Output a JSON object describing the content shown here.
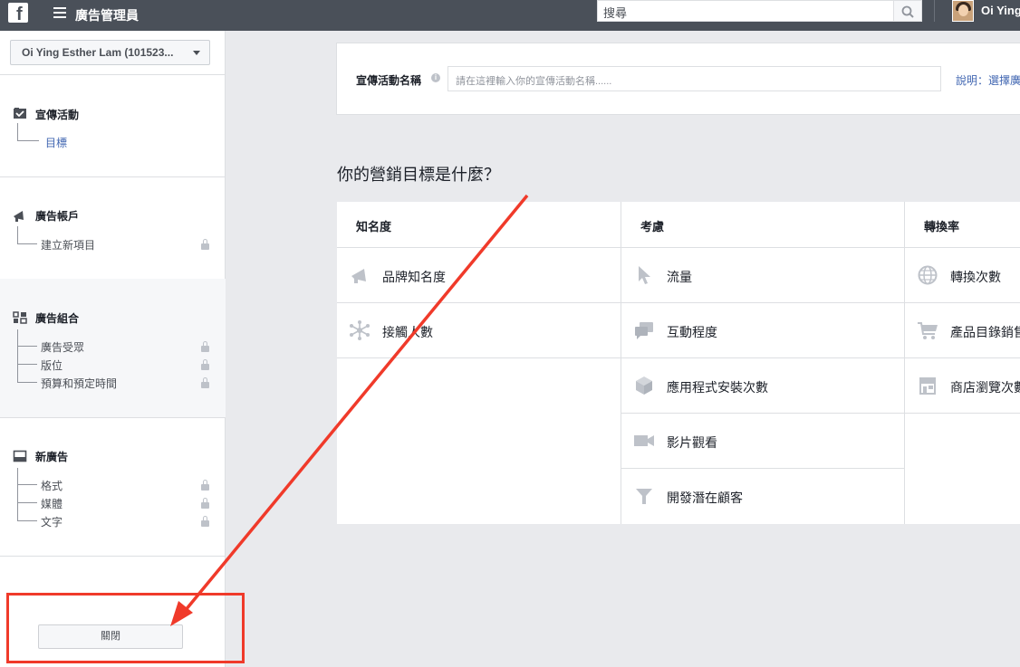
{
  "header": {
    "logo": "f",
    "app_title": "廣告管理員",
    "search_placeholder": "搜尋",
    "user_name": "Oi Ying"
  },
  "sidebar": {
    "account_selector": "Oi Ying Esther Lam (101523...",
    "sections": [
      {
        "title": "宣傳活動",
        "icon": "checkbox-icon",
        "items": [
          {
            "label": "目標",
            "active": true,
            "locked": false
          }
        ]
      },
      {
        "title": "廣告帳戶",
        "icon": "megaphone-icon",
        "items": [
          {
            "label": "建立新項目",
            "active": false,
            "locked": true
          }
        ]
      },
      {
        "title": "廣告組合",
        "icon": "grid-icon",
        "items": [
          {
            "label": "廣告受眾",
            "active": false,
            "locked": true
          },
          {
            "label": "版位",
            "active": false,
            "locked": true
          },
          {
            "label": "預算和預定時間",
            "active": false,
            "locked": true
          }
        ]
      },
      {
        "title": "新廣告",
        "icon": "ad-icon",
        "items": [
          {
            "label": "格式",
            "active": false,
            "locked": true
          },
          {
            "label": "媒體",
            "active": false,
            "locked": true
          },
          {
            "label": "文字",
            "active": false,
            "locked": true
          }
        ]
      }
    ],
    "close_button": "關閉"
  },
  "campaign_name": {
    "label": "宣傳活動名稱",
    "placeholder": "請在這裡輸入你的宣傳活動名稱......",
    "help_link": "說明：選擇廣"
  },
  "objectives": {
    "question": "你的營銷目標是什麼？",
    "columns": [
      {
        "header": "知名度",
        "items": [
          {
            "label": "品牌知名度",
            "icon": "megaphone-icon"
          },
          {
            "label": "接觸人數",
            "icon": "network-icon"
          }
        ]
      },
      {
        "header": "考慮",
        "items": [
          {
            "label": "流量",
            "icon": "cursor-icon"
          },
          {
            "label": "互動程度",
            "icon": "chat-icon"
          },
          {
            "label": "應用程式安裝次數",
            "icon": "box-icon"
          },
          {
            "label": "影片觀看",
            "icon": "video-camera-icon"
          },
          {
            "label": "開發潛在顧客",
            "icon": "funnel-icon"
          }
        ]
      },
      {
        "header": "轉換率",
        "items": [
          {
            "label": "轉換次數",
            "icon": "globe-icon"
          },
          {
            "label": "產品目錄銷售",
            "icon": "cart-icon"
          },
          {
            "label": "商店瀏覽次數",
            "icon": "store-icon"
          }
        ]
      }
    ]
  },
  "colors": {
    "topbar": "#4a5059",
    "link": "#4267b2",
    "annotation": "#f03a2a"
  }
}
